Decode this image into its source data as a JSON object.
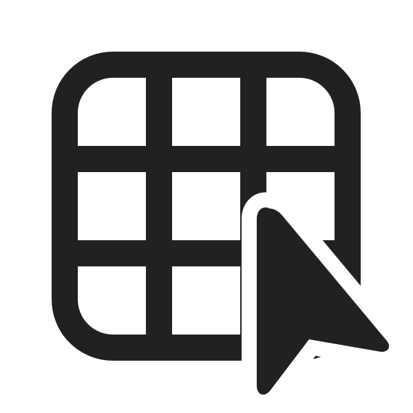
{
  "icon": {
    "name": "table-cursor-icon",
    "components": [
      "grid-table-icon",
      "pointer-cursor-icon"
    ],
    "colors": {
      "ink": "#212121",
      "background": "#ffffff"
    }
  }
}
